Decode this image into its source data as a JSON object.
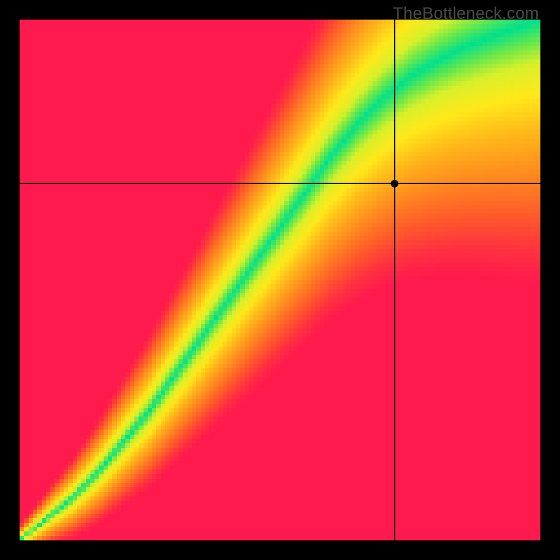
{
  "watermark": "TheBottleneck.com",
  "chart_data": {
    "type": "heatmap",
    "title": "",
    "xlabel": "",
    "ylabel": "",
    "xlim": [
      0,
      1
    ],
    "ylim": [
      0,
      1
    ],
    "x_grid_line": 0.72,
    "y_grid_line": 0.685,
    "marker": {
      "x": 0.72,
      "y": 0.685
    },
    "ridge": {
      "description": "optimal (green) band center as y = f(x) in normalized coords, origin at bottom-left",
      "points": [
        {
          "x": 0.0,
          "y": 0.0
        },
        {
          "x": 0.05,
          "y": 0.04
        },
        {
          "x": 0.1,
          "y": 0.08
        },
        {
          "x": 0.15,
          "y": 0.13
        },
        {
          "x": 0.2,
          "y": 0.19
        },
        {
          "x": 0.25,
          "y": 0.25
        },
        {
          "x": 0.3,
          "y": 0.32
        },
        {
          "x": 0.35,
          "y": 0.39
        },
        {
          "x": 0.4,
          "y": 0.46
        },
        {
          "x": 0.45,
          "y": 0.53
        },
        {
          "x": 0.5,
          "y": 0.6
        },
        {
          "x": 0.55,
          "y": 0.67
        },
        {
          "x": 0.6,
          "y": 0.74
        },
        {
          "x": 0.65,
          "y": 0.8
        },
        {
          "x": 0.7,
          "y": 0.85
        },
        {
          "x": 0.75,
          "y": 0.89
        },
        {
          "x": 0.8,
          "y": 0.92
        },
        {
          "x": 0.85,
          "y": 0.945
        },
        {
          "x": 0.9,
          "y": 0.965
        },
        {
          "x": 0.95,
          "y": 0.983
        },
        {
          "x": 1.0,
          "y": 1.0
        }
      ],
      "half_width_start": 0.004,
      "half_width_end": 0.07
    },
    "color_stops": [
      {
        "t": 0.0,
        "color": "#00e08c"
      },
      {
        "t": 0.08,
        "color": "#6ae84a"
      },
      {
        "t": 0.16,
        "color": "#d8f02a"
      },
      {
        "t": 0.28,
        "color": "#ffe81a"
      },
      {
        "t": 0.42,
        "color": "#ffb81a"
      },
      {
        "t": 0.58,
        "color": "#ff8a1f"
      },
      {
        "t": 0.74,
        "color": "#ff5a2a"
      },
      {
        "t": 0.88,
        "color": "#ff3040"
      },
      {
        "t": 1.0,
        "color": "#ff1a4d"
      }
    ],
    "pixelation": 118
  }
}
